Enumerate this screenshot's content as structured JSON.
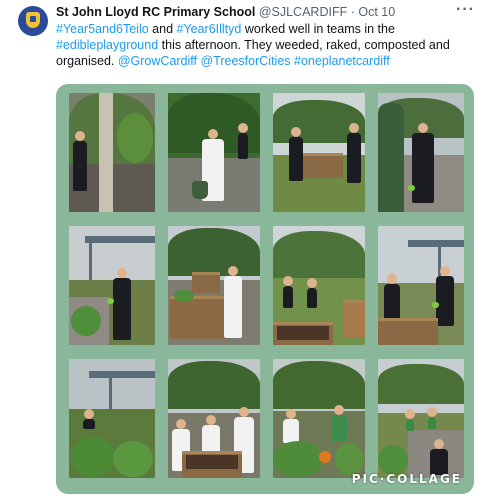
{
  "tweet": {
    "author_name": "St John Lloyd RC Primary School",
    "author_handle": "@SJLCARDIFF",
    "separator": "·",
    "date": "Oct 10",
    "more_label": "···",
    "text_segments": [
      {
        "text": "#Year5and6Teilo",
        "link": true
      },
      {
        "text": " and ",
        "link": false
      },
      {
        "text": "#Year6Illtyd",
        "link": true
      },
      {
        "text": " worked well in teams in the ",
        "link": false
      },
      {
        "text": "#edibleplayground",
        "link": true
      },
      {
        "text": " this afternoon. They weeded, raked, composted and organised. ",
        "link": false
      },
      {
        "text": "@GrowCardiff",
        "link": true
      },
      {
        "text": " ",
        "link": false
      },
      {
        "text": "@TreesforCities",
        "link": true
      },
      {
        "text": " ",
        "link": false
      },
      {
        "text": "#oneplanetcardiff",
        "link": true
      }
    ]
  },
  "collage": {
    "watermark": "PIC·COLLAGE",
    "background_color": "#8ab79a",
    "photo_count": 12
  },
  "colors": {
    "link": "#1d9bf0",
    "text": "#0f1419",
    "muted": "#536471"
  }
}
